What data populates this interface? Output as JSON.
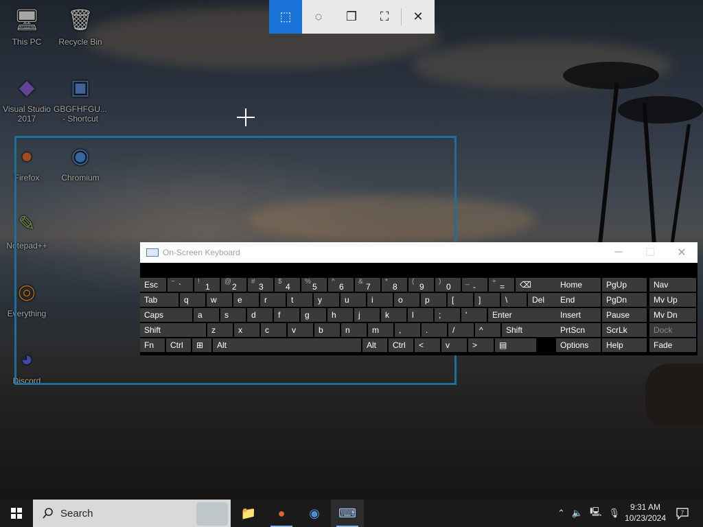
{
  "desktop": {
    "icons": [
      {
        "label": "This PC",
        "glyph": "🖥"
      },
      {
        "label": "Recycle Bin",
        "glyph": "🗑"
      },
      {
        "label": "Visual Studio 2017",
        "glyph": "◆"
      },
      {
        "label": "GBGFHFGU... - Shortcut",
        "glyph": "▣"
      },
      {
        "label": "Firefox",
        "glyph": "●"
      },
      {
        "label": "Chromium",
        "glyph": "◉"
      },
      {
        "label": "Notepad++",
        "glyph": "✎"
      },
      {
        "label": "Everything",
        "glyph": "◎"
      },
      {
        "label": "Discord",
        "glyph": "◕"
      }
    ]
  },
  "snip_toolbar": {
    "buttons": [
      {
        "name": "rectangular-snip",
        "glyph": "⬚",
        "active": true
      },
      {
        "name": "freeform-snip",
        "glyph": "◌",
        "active": false
      },
      {
        "name": "window-snip",
        "glyph": "❐",
        "active": false
      },
      {
        "name": "fullscreen-snip",
        "glyph": "⛶",
        "active": false
      }
    ],
    "close_glyph": "✕"
  },
  "osk": {
    "title": "On-Screen Keyboard",
    "controls": {
      "minimize": "─",
      "maximize": "☐",
      "close": "✕"
    },
    "row1": [
      {
        "label": "Esc"
      },
      {
        "shift": "~",
        "main": "`"
      },
      {
        "shift": "!",
        "main": "1"
      },
      {
        "shift": "@",
        "main": "2"
      },
      {
        "shift": "#",
        "main": "3"
      },
      {
        "shift": "$",
        "main": "4"
      },
      {
        "shift": "%",
        "main": "5"
      },
      {
        "shift": "^",
        "main": "6"
      },
      {
        "shift": "&",
        "main": "7"
      },
      {
        "shift": "*",
        "main": "8"
      },
      {
        "shift": "(",
        "main": "9"
      },
      {
        "shift": ")",
        "main": "0"
      },
      {
        "shift": "_",
        "main": "-"
      },
      {
        "shift": "+",
        "main": "="
      },
      {
        "label": "⌫"
      }
    ],
    "row2": [
      "Tab",
      "q",
      "w",
      "e",
      "r",
      "t",
      "y",
      "u",
      "i",
      "o",
      "p",
      "[",
      "]",
      "\\",
      "Del"
    ],
    "row3": [
      "Caps",
      "a",
      "s",
      "d",
      "f",
      "g",
      "h",
      "j",
      "k",
      "l",
      ";",
      "'",
      "Enter"
    ],
    "row4": [
      "Shift",
      "z",
      "x",
      "c",
      "v",
      "b",
      "n",
      "m",
      ",",
      ".",
      "/",
      "^",
      "Shift"
    ],
    "row5": [
      "Fn",
      "Ctrl",
      "⊞",
      "Alt",
      "Alt",
      "Ctrl",
      "<",
      "v",
      ">",
      "▤"
    ],
    "nav": [
      [
        "Home",
        "PgUp",
        "Nav"
      ],
      [
        "End",
        "PgDn",
        "Mv Up"
      ],
      [
        "Insert",
        "Pause",
        "Mv Dn"
      ],
      [
        "PrtScn",
        "ScrLk",
        "Dock"
      ],
      [
        "Options",
        "Help",
        "Fade"
      ]
    ]
  },
  "taskbar": {
    "search_label": "Search",
    "apps": [
      {
        "name": "file-explorer",
        "glyph": "📁"
      },
      {
        "name": "firefox",
        "glyph": "●"
      },
      {
        "name": "chromium",
        "glyph": "◉"
      },
      {
        "name": "on-screen-keyboard",
        "glyph": "⌨"
      }
    ],
    "time": "9:31 AM",
    "date": "10/23/2024"
  }
}
